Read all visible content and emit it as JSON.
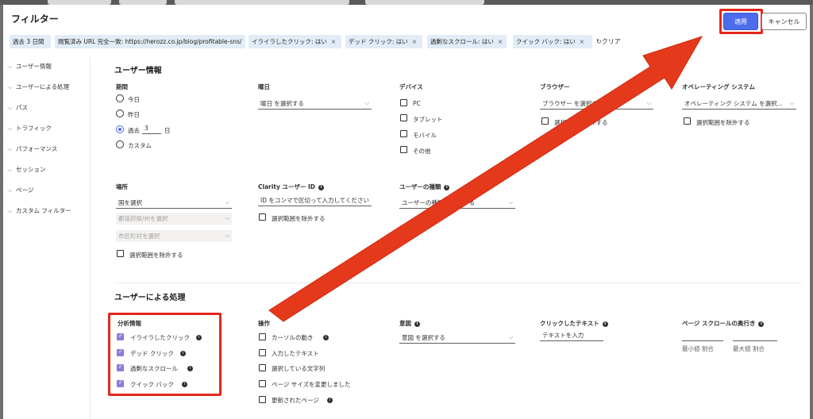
{
  "dialog": {
    "title": "フィルター",
    "apply_label": "適用",
    "cancel_label": "キャンセル"
  },
  "chips": [
    {
      "label": "過去 3 日間",
      "close": ""
    },
    {
      "label": "閲覧済み URL 完全一致: https://herozz.co.jp/blog/profitable-sns/",
      "close": "×"
    },
    {
      "label": "イライラしたクリック: はい",
      "close": "×"
    },
    {
      "label": "デッド クリック: はい",
      "close": "×"
    },
    {
      "label": "過剰なスクロール: はい",
      "close": "×"
    },
    {
      "label": "クイック バック: はい",
      "close": "×"
    }
  ],
  "clear_label": "クリア",
  "sidebar": {
    "items": [
      {
        "label": "ユーザー情報"
      },
      {
        "label": "ユーザーによる処理"
      },
      {
        "label": "パス"
      },
      {
        "label": "トラフィック"
      },
      {
        "label": "パフォーマンス"
      },
      {
        "label": "セッション"
      },
      {
        "label": "ページ"
      },
      {
        "label": "カスタム フィルター"
      }
    ]
  },
  "user_info": {
    "title": "ユーザー情報",
    "period": {
      "label": "期間",
      "options": [
        "今日",
        "昨日",
        "過去",
        "カスタム"
      ],
      "days_value": "3",
      "days_unit": "日"
    },
    "weekday": {
      "label": "曜日",
      "placeholder": "曜日 を選択する"
    },
    "device": {
      "label": "デバイス",
      "options": [
        "PC",
        "タブレット",
        "モバイル",
        "その他"
      ]
    },
    "browser": {
      "label": "ブラウザー",
      "placeholder": "ブラウザー を選択する",
      "exclude": "選択範囲を除外する"
    },
    "os": {
      "label": "オペレーティング システム",
      "placeholder": "オペレーティング システム を選択...",
      "exclude": "選択範囲を除外する"
    },
    "location": {
      "label": "場所",
      "country": "国を選択",
      "prefecture": "都道府県/州を選択",
      "city": "市区町村を選択",
      "exclude": "選択範囲を除外する"
    },
    "clarity_id": {
      "label": "Clarity ユーザー ID",
      "placeholder": "ID をコンマで区切って入力してください",
      "exclude": "選択範囲を除外する"
    },
    "user_type": {
      "label": "ユーザーの種類",
      "placeholder": "ユーザーの種類 を選択する"
    }
  },
  "user_actions": {
    "title": "ユーザーによる処理",
    "insights": {
      "label": "分析情報",
      "options": [
        "イライラしたクリック",
        "デッド クリック",
        "過剰なスクロール",
        "クイック バック"
      ]
    },
    "actions": {
      "label": "操作",
      "options": [
        "カーソルの動き",
        "入力したテキスト",
        "選択している文字列",
        "ページ サイズを変更しました",
        "更新されたページ"
      ]
    },
    "intent": {
      "label": "意図",
      "placeholder": "意図 を選択する"
    },
    "clicked_text": {
      "label": "クリックしたテキスト",
      "placeholder": "テキストを入力"
    },
    "scroll_depth": {
      "label": "ページ スクロールの奥行き",
      "min": "最小値 割合",
      "max": "最大値 割合"
    }
  },
  "colors": {
    "accent": "#4f6bed",
    "highlight": "#e4281a",
    "chip_bg": "#e1ecf7",
    "checkbox_on": "#8a7fd6"
  }
}
